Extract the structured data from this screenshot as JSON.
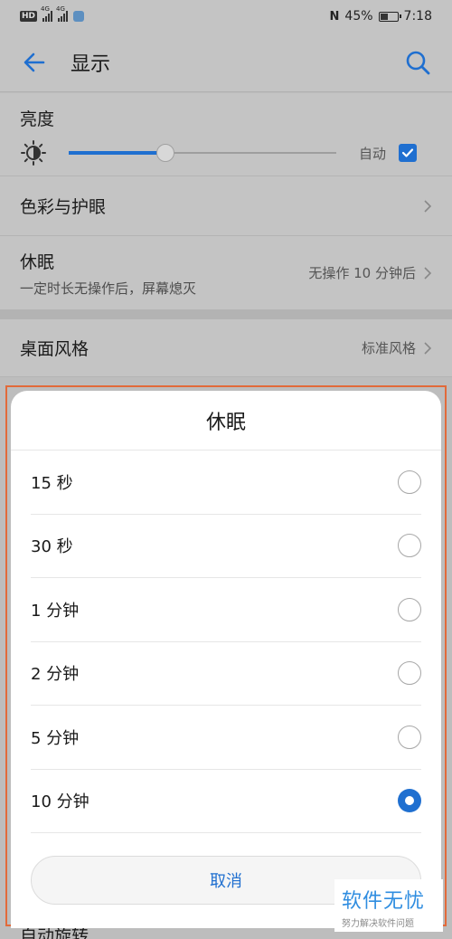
{
  "status_bar": {
    "signal_tags": [
      "4G",
      "4G"
    ],
    "hd_badge": "HD",
    "nfc": "N",
    "battery_percent": "45%",
    "battery_level": 0.45,
    "time": "7:18"
  },
  "header": {
    "title": "显示",
    "back_icon": "arrow-left-icon",
    "search_icon": "search-icon"
  },
  "brightness": {
    "title": "亮度",
    "level": 0.36,
    "auto_label": "自动",
    "auto_checked": true
  },
  "color_row": {
    "title": "色彩与护眼"
  },
  "sleep_row": {
    "title": "休眠",
    "subtitle": "一定时长无操作后，屏幕熄灭",
    "value": "无操作 10 分钟后"
  },
  "theme_row": {
    "title": "桌面风格",
    "value": "标准风格"
  },
  "dialog": {
    "title": "休眠",
    "options": [
      {
        "label": "15 秒",
        "selected": false
      },
      {
        "label": "30 秒",
        "selected": false
      },
      {
        "label": "1 分钟",
        "selected": false
      },
      {
        "label": "2 分钟",
        "selected": false
      },
      {
        "label": "5 分钟",
        "selected": false
      },
      {
        "label": "10 分钟",
        "selected": true
      }
    ],
    "cancel_label": "取消"
  },
  "bottom_peek": {
    "title": "自动旋转"
  },
  "watermark": {
    "main": "软件无忧",
    "sub": "努力解决软件问题"
  },
  "colors": {
    "accent": "#1f6fd0",
    "highlight_border": "#e26a3a",
    "watermark_text": "#2f8de0"
  }
}
